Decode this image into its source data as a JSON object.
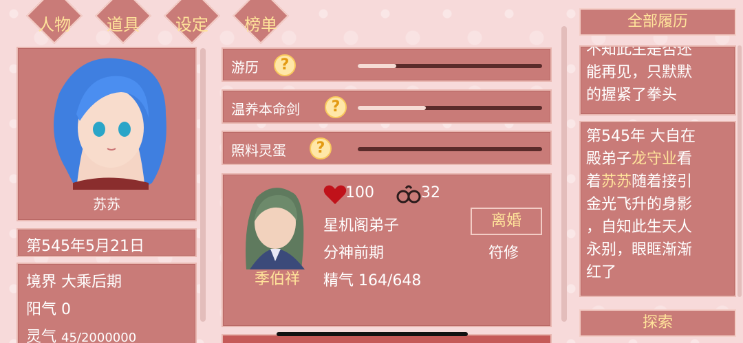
{
  "tabs": [
    {
      "label": "人物"
    },
    {
      "label": "道具"
    },
    {
      "label": "设定"
    },
    {
      "label": "榜单"
    }
  ],
  "character": {
    "name": "苏苏",
    "date": "第545年5月21日",
    "realm_label": "境界",
    "realm_value": "大乘后期",
    "yang_label": "阳气",
    "yang_value": "0",
    "ling_label": "灵气",
    "ling_value": "45/2000000"
  },
  "activities": [
    {
      "label": "游历",
      "progress": 0.21
    },
    {
      "label": "温养本命剑",
      "progress": 0.37
    },
    {
      "label": "照料灵蛋",
      "progress": 0.0
    }
  ],
  "spouse": {
    "name": "季伯祥",
    "hearts": "100",
    "rings": "32",
    "sect": "星机阁弟子",
    "stage": "分神前期",
    "essence_label": "精气",
    "essence_value": "164/648",
    "divorce_label": "离婚",
    "role": "符修"
  },
  "history": {
    "title": "全部履历",
    "entry1_top": "不知此生是否还",
    "entry1_lines": [
      "能再见，只默默",
      "的握紧了拳头"
    ],
    "entry2": {
      "l1": "第545年 大自在",
      "l2a": "殿弟子",
      "l2b": "龙守业",
      "l2c": "看",
      "l3a": "着",
      "l3b": "苏苏",
      "l3c": "随着接引",
      "l4": "金光飞升的身影",
      "l5": "，自知此生天人",
      "l6": "永别，眼眶渐渐",
      "l7": "红了"
    },
    "explore_label": "探索"
  },
  "colors": {
    "panel": "#c97b78",
    "accent_text": "#ffe39a",
    "background": "#f7dada"
  }
}
